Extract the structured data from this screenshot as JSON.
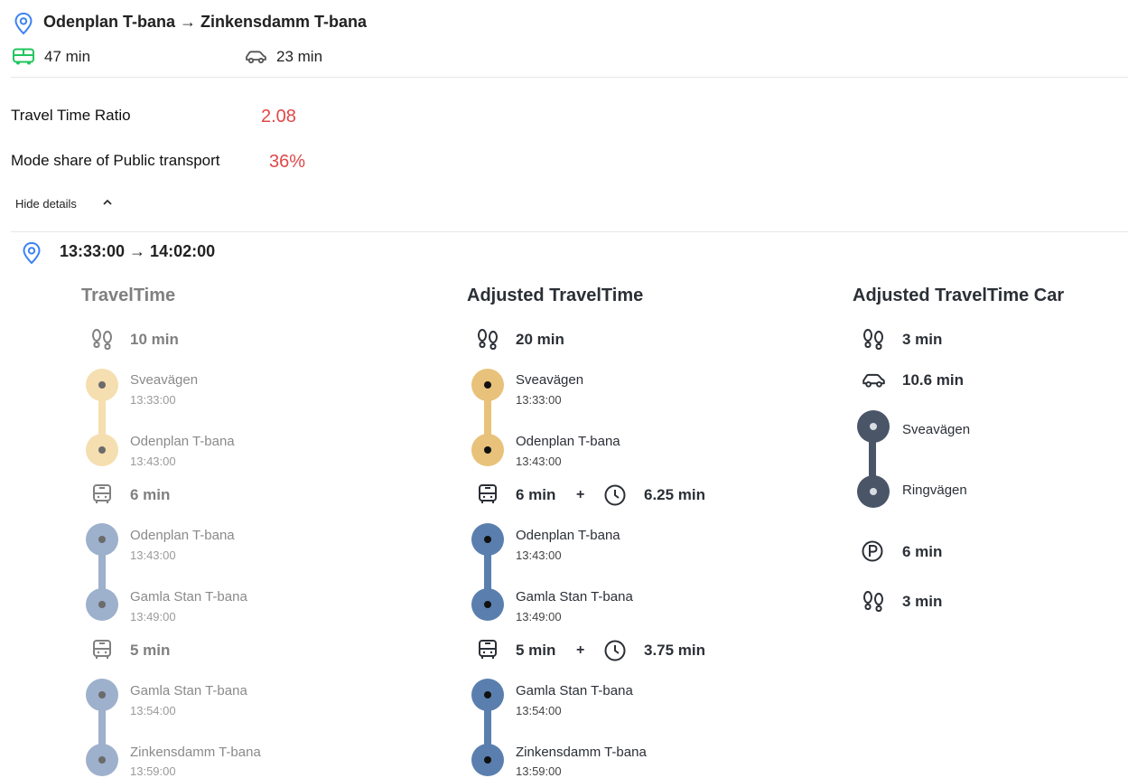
{
  "route": {
    "title": "Odenplan T-bana → Zinkensdamm T-bana",
    "public_transport_time": "47 min",
    "car_time": "23 min"
  },
  "metrics": {
    "travel_time_ratio_label": "Travel Time Ratio",
    "travel_time_ratio_value": "2.08",
    "mode_share_label": "Mode share of Public transport",
    "mode_share_value": "36%"
  },
  "details": {
    "toggle_label": "Hide details",
    "time_range": "13:33:00 → 14:02:00"
  },
  "colors": {
    "walk": "#f5deb0",
    "walk_strong": "#e8c27a",
    "transit_muted": "#9db0cc",
    "transit_strong": "#5a7fae",
    "car": "#4a5568",
    "accent_red": "#e04848",
    "pin_blue": "#3b82f6",
    "bus_green": "#22c55e"
  },
  "columns": {
    "travel_time": {
      "title": "TravelTime",
      "walk_duration": "10 min",
      "walk_from": {
        "name": "Sveavägen",
        "time": "13:33:00"
      },
      "walk_to": {
        "name": "Odenplan T-bana",
        "time": "13:43:00"
      },
      "leg1_duration": "6 min",
      "leg1_from": {
        "name": "Odenplan T-bana",
        "time": "13:43:00"
      },
      "leg1_to": {
        "name": "Gamla Stan T-bana",
        "time": "13:49:00"
      },
      "leg2_duration": "5 min",
      "leg2_from": {
        "name": "Gamla Stan T-bana",
        "time": "13:54:00"
      },
      "leg2_to": {
        "name": "Zinkensdamm T-bana",
        "time": "13:59:00"
      }
    },
    "adjusted": {
      "title": "Adjusted TravelTime",
      "walk_duration": "20 min",
      "walk_from": {
        "name": "Sveavägen",
        "time": "13:33:00"
      },
      "walk_to": {
        "name": "Odenplan T-bana",
        "time": "13:43:00"
      },
      "leg1_duration": "6 min",
      "leg1_plus": "+",
      "leg1_wait": "6.25 min",
      "leg1_from": {
        "name": "Odenplan T-bana",
        "time": "13:43:00"
      },
      "leg1_to": {
        "name": "Gamla Stan T-bana",
        "time": "13:49:00"
      },
      "leg2_duration": "5 min",
      "leg2_plus": "+",
      "leg2_wait": "3.75 min",
      "leg2_from": {
        "name": "Gamla Stan T-bana",
        "time": "13:54:00"
      },
      "leg2_to": {
        "name": "Zinkensdamm T-bana",
        "time": "13:59:00"
      }
    },
    "car": {
      "title": "Adjusted TravelTime Car",
      "walk_start": "3 min",
      "drive": "10.6 min",
      "from": "Sveavägen",
      "to": "Ringvägen",
      "parking": "6 min",
      "walk_end": "3 min"
    }
  }
}
